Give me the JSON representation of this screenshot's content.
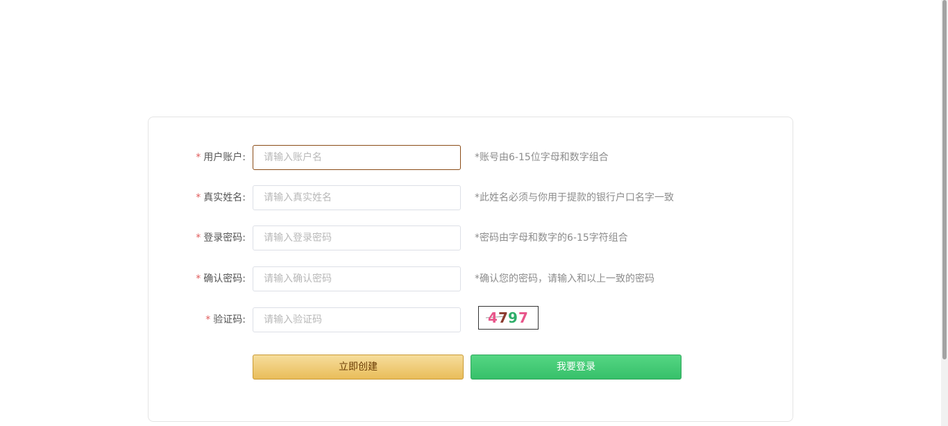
{
  "form": {
    "fields": [
      {
        "required_mark": "*",
        "label": "用户账户:",
        "value": "",
        "placeholder": "请输入账户名",
        "hint": "*账号由6-15位字母和数字组合"
      },
      {
        "required_mark": "*",
        "label": "真实姓名:",
        "value": "",
        "placeholder": "请输入真实姓名",
        "hint": "*此姓名必须与你用于提款的银行户口名字一致"
      },
      {
        "required_mark": "*",
        "label": "登录密码:",
        "value": "",
        "placeholder": "请输入登录密码",
        "hint": "*密码由字母和数字的6-15字符组合"
      },
      {
        "required_mark": "*",
        "label": "确认密码:",
        "value": "",
        "placeholder": "请输入确认密码",
        "hint": "*确认您的密码，请输入和以上一致的密码"
      },
      {
        "required_mark": "*",
        "label": "验证码:",
        "value": "",
        "placeholder": "请输入验证码"
      }
    ],
    "captcha": {
      "code": "4797",
      "digit_colors": [
        "#e8558a",
        "#8b3a2f",
        "#2fae6a",
        "#e8558a"
      ]
    },
    "buttons": {
      "create_label": "立即创建",
      "login_label": "我要登录"
    }
  },
  "colors": {
    "required": "#e05b5b",
    "focus_border": "#8a4b16",
    "create_button": "#e9bd5a",
    "login_button": "#37c06a"
  }
}
